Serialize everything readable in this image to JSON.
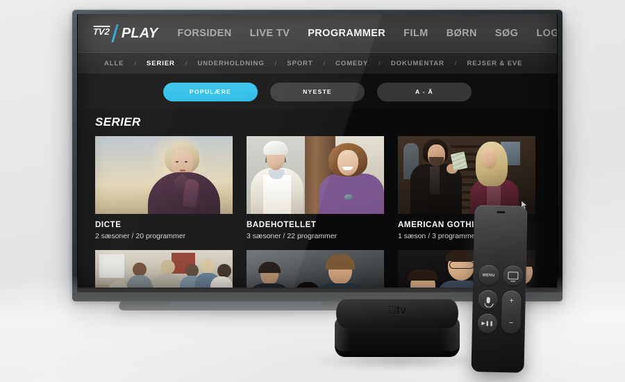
{
  "device": {
    "tv_label": "television",
    "set_top_box": {
      "brand_glyph": "",
      "name": "tv"
    },
    "remote": {
      "menu_label": "MENU",
      "tv_button": "tv-button",
      "mic_button": "siri-microphone-button",
      "playpause_label": "▶❚❚",
      "volume_up": "+",
      "volume_down": "−"
    }
  },
  "app": {
    "logo": {
      "mark": "TV2",
      "word": "PLAY",
      "accent_color": "#2aaee0"
    },
    "nav": [
      {
        "label": "FORSIDEN",
        "active": false
      },
      {
        "label": "LIVE TV",
        "active": false
      },
      {
        "label": "PROGRAMMER",
        "active": true
      },
      {
        "label": "FILM",
        "active": false
      },
      {
        "label": "BØRN",
        "active": false
      },
      {
        "label": "SØG",
        "active": false
      },
      {
        "label": "LOG IND",
        "active": false
      }
    ],
    "subnav": {
      "separator": "/",
      "items": [
        {
          "label": "ALLE",
          "active": false
        },
        {
          "label": "SERIER",
          "active": true
        },
        {
          "label": "UNDERHOLDNING",
          "active": false
        },
        {
          "label": "SPORT",
          "active": false
        },
        {
          "label": "COMEDY",
          "active": false
        },
        {
          "label": "DOKUMENTAR",
          "active": false
        },
        {
          "label": "REJSER & EVE",
          "active": false
        }
      ]
    },
    "filters": [
      {
        "label": "POPULÆRE",
        "active": true
      },
      {
        "label": "NYESTE",
        "active": false
      },
      {
        "label": "A - Å",
        "active": false
      }
    ],
    "section_title": "SERIER",
    "cards": [
      {
        "title": "DICTE",
        "meta": "2 sæsoner  /  20 programmer",
        "art": "blonde-woman-sky"
      },
      {
        "title": "BADEHOTELLET",
        "meta": "3 sæsoner  /  22 programmer",
        "art": "maid-and-woman-hotel"
      },
      {
        "title": "AMERICAN GOTHIC",
        "meta": "1 sæson / 3 programmer",
        "art": "man-cash-blonde-woman"
      }
    ],
    "cards_row2": [
      {
        "art": "family-dinner-table"
      },
      {
        "art": "dark-trio-portrait"
      },
      {
        "art": "smiling-group-night"
      }
    ]
  },
  "colors": {
    "accent": "#21b9e6",
    "screen_bg": "#0a0a0b",
    "topbar_bg": "#3f3f3f",
    "subnav_bg": "#222222",
    "pill_bg": "#373737"
  }
}
